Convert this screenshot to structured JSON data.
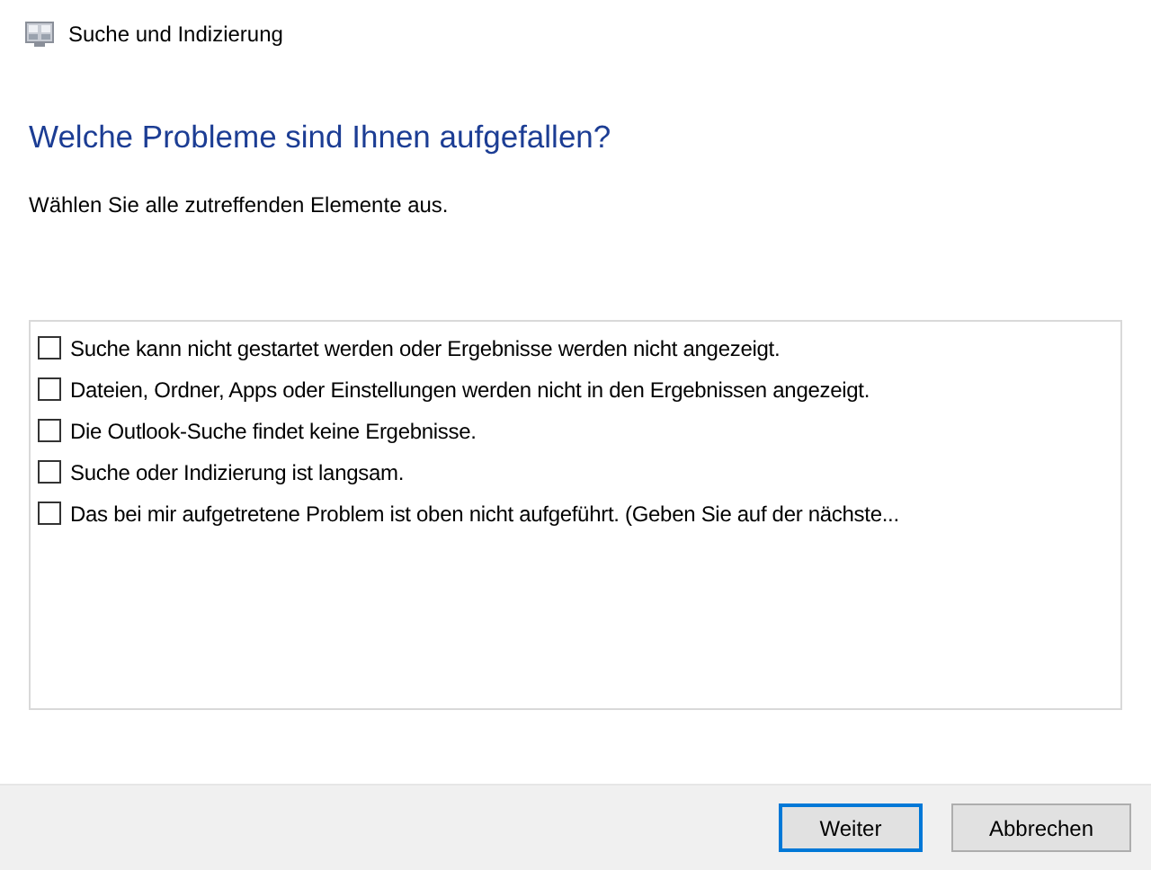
{
  "window": {
    "title": "Suche und Indizierung"
  },
  "heading": "Welche Probleme sind Ihnen aufgefallen?",
  "instruction": "Wählen Sie alle zutreffenden Elemente aus.",
  "problems": [
    {
      "label": "Suche kann nicht gestartet werden oder Ergebnisse werden nicht angezeigt.",
      "checked": false
    },
    {
      "label": "Dateien, Ordner, Apps oder Einstellungen werden nicht in den Ergebnissen angezeigt.",
      "checked": false
    },
    {
      "label": "Die Outlook-Suche findet keine Ergebnisse.",
      "checked": false
    },
    {
      "label": "Suche oder Indizierung ist langsam.",
      "checked": false
    },
    {
      "label": "Das bei mir aufgetretene Problem ist oben nicht aufgeführt. (Geben Sie auf der nächste...",
      "checked": false
    }
  ],
  "buttons": [
    {
      "label": "Weiter",
      "default": true
    },
    {
      "label": "Abbrechen",
      "default": false
    }
  ]
}
